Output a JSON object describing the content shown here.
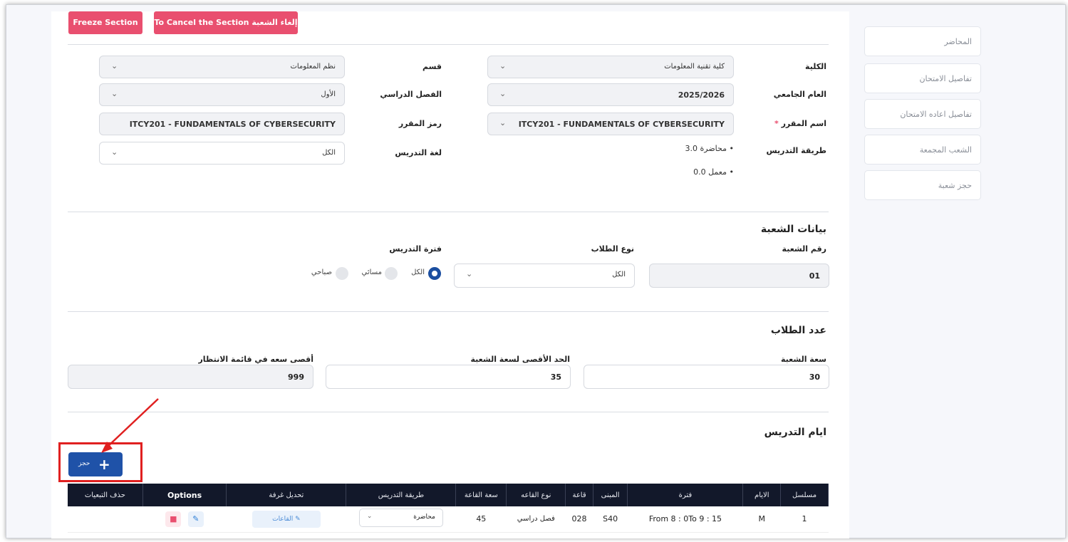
{
  "sidebar": {
    "items": [
      {
        "label": "المحاضر"
      },
      {
        "label": "تفاصيل الامتحان"
      },
      {
        "label": "تفاصيل اعاده الامتحان"
      },
      {
        "label": "الشعب المجمعة"
      },
      {
        "label": "حجز شعبة"
      }
    ]
  },
  "toolbar": {
    "freeze_label": "Freeze Section",
    "cancel_label": "To Cancel the Section إلغاء الشعبة"
  },
  "course": {
    "college_label": "الكلية",
    "college_value": "كلية تقنية المعلومات",
    "department_label": "قسم",
    "department_value": "نظم المعلومات",
    "year_label": "العام الجامعي",
    "year_value": "2025/2026",
    "semester_label": "الفصل الدراسي",
    "semester_value": "الأول",
    "course_name_label": "اسم المقرر",
    "required_mark": "*",
    "course_name_value": "ITCY201 - FUNDAMENTALS OF CYBERSECURITY",
    "course_code_label": "رمز المقرر",
    "course_code_value": "ITCY201 - FUNDAMENTALS OF CYBERSECURITY",
    "teaching_method_label": "طريقة التدريس",
    "teaching_method_items": [
      "محاضرة 3.0",
      "معمل 0.0"
    ],
    "teaching_language_label": "لغة التدريس",
    "teaching_language_value": "الكل"
  },
  "section": {
    "title": "بيانات الشعبة",
    "number_label": "رقم الشعبة",
    "number_value": "01",
    "student_type_label": "نوع الطلاب",
    "student_type_value": "الكل",
    "period_label": "فترة التدريس",
    "period_options": [
      {
        "label": "الكل",
        "selected": true
      },
      {
        "label": "مسائي",
        "selected": false
      },
      {
        "label": "صباحي",
        "selected": false
      }
    ]
  },
  "students": {
    "title": "عدد الطلاب",
    "capacity_label": "سعة الشعبة",
    "capacity_value": "30",
    "max_capacity_label": "الحد الأقصى لسعة الشعبة",
    "max_capacity_value": "35",
    "waitlist_label": "أقصى سعه في قائمة الانتظار",
    "waitlist_value": "999"
  },
  "schedule": {
    "title": "ايام التدريس",
    "add_label": "حجز",
    "columns": [
      "مسلسل",
      "الايام",
      "فترة",
      "المبنى",
      "قاعة",
      "نوع القاعه",
      "سعة القاعة",
      "طريقة التدريس",
      "تحديل غرفة",
      "Options",
      "حذف التبعيات"
    ],
    "rows": [
      {
        "serial": "1",
        "day": "M",
        "period": "From 8 : 0To 9 : 15",
        "building": "S40",
        "room": "028",
        "room_type": "فصل دراسي",
        "capacity": "45",
        "method": "محاضرة",
        "halls": "القاعات"
      }
    ]
  },
  "icons": {
    "chevron": "chevron-down-icon",
    "plus": "plus-icon",
    "edit": "edit-icon",
    "delete": "trash-icon"
  },
  "colors": {
    "primary": "#1f52a8",
    "danger": "#e94f6f",
    "table_header": "#12182a",
    "annotation": "#e02020"
  }
}
